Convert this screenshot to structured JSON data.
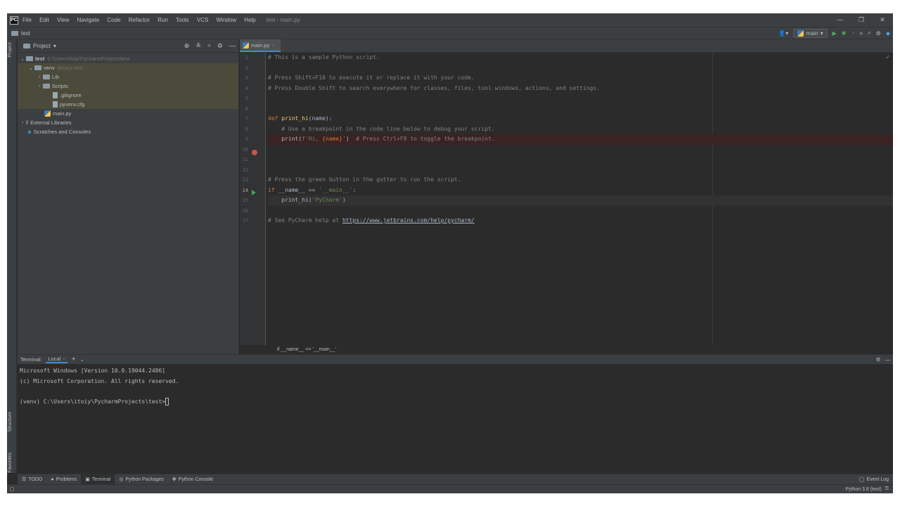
{
  "window": {
    "logo": "PC",
    "menu": [
      "File",
      "Edit",
      "View",
      "Navigate",
      "Code",
      "Refactor",
      "Run",
      "Tools",
      "VCS",
      "Window",
      "Help"
    ],
    "title": "test - main.py",
    "controls": [
      "—",
      "❐",
      "✕"
    ]
  },
  "navbar": {
    "breadcrumb": "test",
    "run_config": "main"
  },
  "side_tabs": {
    "project": "Project",
    "structure": "Structure",
    "favorites": "Favorites"
  },
  "project_panel": {
    "title": "Project",
    "tree": [
      {
        "label": "test",
        "hint": "C:\\Users\\itoiy\\PycharmProjects\\test"
      },
      {
        "label": "venv",
        "hint": "library root"
      },
      {
        "label": "Lib"
      },
      {
        "label": "Scripts"
      },
      {
        "label": ".gitignore"
      },
      {
        "label": "pyvenv.cfg"
      },
      {
        "label": "main.py"
      },
      {
        "label": "External Libraries"
      },
      {
        "label": "Scratches and Consoles"
      }
    ]
  },
  "editor": {
    "tab": "main.py",
    "line_numbers": [
      "1",
      "2",
      "3",
      "4",
      "5",
      "6",
      "7",
      "8",
      "9",
      "10",
      "11",
      "12",
      "13",
      "14",
      "15",
      "16",
      "17"
    ],
    "lines": {
      "l1": "# This is a sample Python script.",
      "l3": "# Press Shift+F10 to execute it or replace it with your code.",
      "l4": "# Press Double Shift to search everywhere for classes, files, tool windows, actions, and settings.",
      "l7_kw": "def ",
      "l7_fn": "print_hi",
      "l7_rest": "(name):",
      "l8": "    # Use a breakpoint in the code line below to debug your script.",
      "l9_a": "    print(",
      "l9_str": "f'Hi, ",
      "l9_var": "{name}",
      "l9_str2": "'",
      "l9_b": ")  ",
      "l9_cm": "# Press Ctrl+F8 to toggle the breakpoint.",
      "l12": "# Press the green button in the gutter to run the script.",
      "l13_kw": "if ",
      "l13_a": "__name__ == ",
      "l13_str": "'__main__'",
      "l13_b": ":",
      "l14_a": "    print_hi(",
      "l14_str": "'PyCharm'",
      "l14_b": ")",
      "l16_cm": "# See PyCharm help at ",
      "l16_link": "https://www.jetbrains.com/help/pycharm/"
    },
    "breadcrumb": "if __name__ == '__main__'"
  },
  "terminal": {
    "label": "Terminal:",
    "tab": "Local",
    "lines": [
      "Microsoft Windows [Version 10.0.19044.2486]",
      "(c) Microsoft Corporation. All rights reserved.",
      "",
      "(venv) C:\\Users\\itoiy\\PycharmProjects\\test>"
    ]
  },
  "tool_windows": [
    "TODO",
    "Problems",
    "Terminal",
    "Python Packages",
    "Python Console"
  ],
  "event_log": "Event Log",
  "status": {
    "interpreter": "Python 3.8 (test)"
  }
}
